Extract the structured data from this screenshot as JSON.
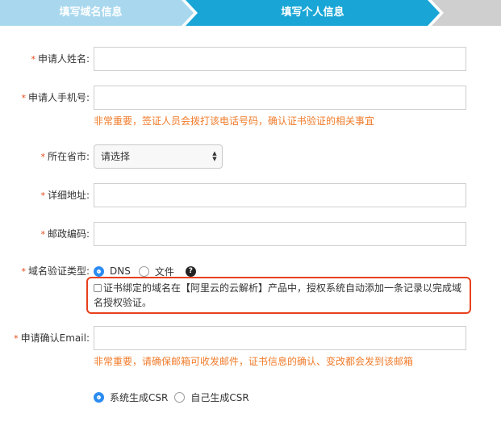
{
  "steps": [
    {
      "label": "填写域名信息",
      "state": "done",
      "color": "#a9d8ee"
    },
    {
      "label": "填写个人信息",
      "state": "active",
      "color": "#19a6d6"
    }
  ],
  "form": {
    "required_mark": "*",
    "applicant_name": {
      "label": "申请人姓名:",
      "value": ""
    },
    "applicant_phone": {
      "label": "申请人手机号:",
      "value": "",
      "hint": "非常重要，签证人员会拨打该电话号码，确认证书验证的相关事宜"
    },
    "province_city": {
      "label": "所在省市:",
      "selected": "请选择"
    },
    "address": {
      "label": "详细地址:",
      "value": ""
    },
    "postal_code": {
      "label": "邮政编码:",
      "value": ""
    },
    "domain_verify": {
      "label": "域名验证类型:",
      "options": [
        {
          "label": "DNS",
          "selected": true
        },
        {
          "label": "文件",
          "selected": false
        }
      ],
      "help": "?",
      "callout_text": "证书绑定的域名在【阿里云的云解析】产品中，授权系统自动添加一条记录以完成域名授权验证。",
      "callout_checked": false
    },
    "confirm_email": {
      "label": "申请确认Email:",
      "value": "",
      "hint": "非常重要，请确保邮箱可收发邮件，证书信息的确认、变改都会发到该邮箱"
    },
    "csr": {
      "options": [
        {
          "label": "系统生成CSR",
          "selected": true
        },
        {
          "label": "自己生成CSR",
          "selected": false
        }
      ]
    }
  },
  "colors": {
    "accent": "#2b8cf1",
    "hint": "#f07b2a",
    "callout_border": "#e8401c"
  }
}
